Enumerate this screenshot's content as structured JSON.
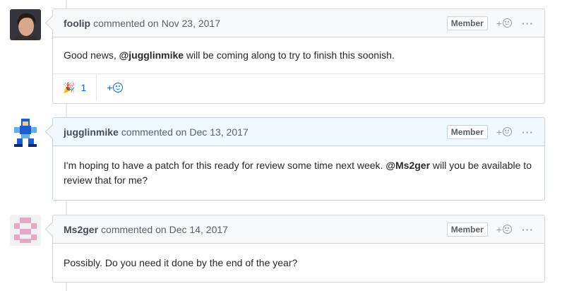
{
  "comments": [
    {
      "author": "foolip",
      "action": "commented on",
      "date": "Nov 23, 2017",
      "badge": "Member",
      "react_plus": "+",
      "more": "···",
      "body_prefix": "Good news, ",
      "mention": "@jugglinmike",
      "body_suffix": " will be coming along to try to finish this soonish.",
      "reaction_emoji": "🎉",
      "reaction_count": "1",
      "add_reaction_plus": "+"
    },
    {
      "author": "jugglinmike",
      "action": "commented on",
      "date": "Dec 13, 2017",
      "badge": "Member",
      "react_plus": "+",
      "more": "···",
      "body_prefix": "I'm hoping to have a patch for this ready for review some time next week. ",
      "mention": "@Ms2ger",
      "body_suffix": " will you be available to review that for me?"
    },
    {
      "author": "Ms2ger",
      "action": "commented on",
      "date": "Dec 14, 2017",
      "badge": "Member",
      "react_plus": "+",
      "more": "···",
      "body": "Possibly. Do you need it done by the end of the year?"
    }
  ],
  "avatars": {
    "foolip": {
      "bg": "#3a2a20",
      "face": "#d9a88a"
    },
    "jugglinmike": {
      "primary": "#1a5fd0",
      "secondary": "#5fb0f0"
    },
    "ms2ger": {
      "color": "#e8a8c8",
      "bg": "#f5f5f5"
    }
  }
}
